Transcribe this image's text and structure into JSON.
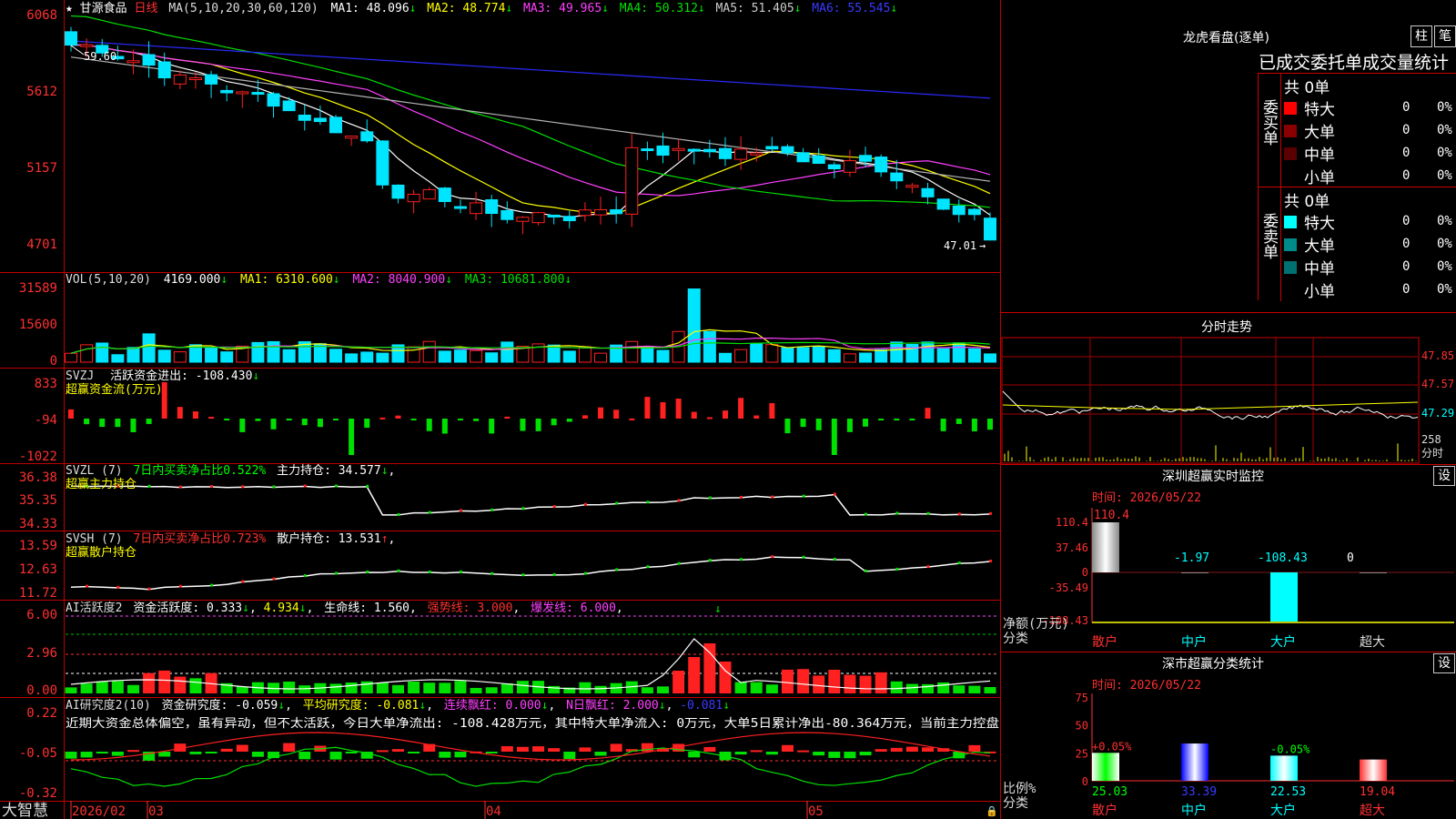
{
  "colors": {
    "up": "#ff2020",
    "down": "#00e5ff",
    "grid": "#a00000",
    "axis": "#ff3030",
    "white": "#ffffff",
    "yellow": "#ffff00",
    "magenta": "#ff40ff",
    "green": "#00e000",
    "blue": "#2a2aff",
    "gray": "#b4b4b4",
    "cyan": "#00ffff"
  },
  "header": {
    "star": "★",
    "stock": "甘源食品",
    "period": "日线",
    "ma_spec": "MA(5,10,20,30,60,120)",
    "ma": [
      {
        "label": "MA1: 48.096",
        "arrow": "↓"
      },
      {
        "label": "MA2: 48.774",
        "arrow": "↓"
      },
      {
        "label": "MA3: 49.965",
        "arrow": "↓"
      },
      {
        "label": "MA4: 50.312",
        "arrow": "↓"
      },
      {
        "label": "MA5: 51.405",
        "arrow": "↓"
      },
      {
        "label": "MA6: 55.545",
        "arrow": "↓"
      }
    ]
  },
  "price_panel": {
    "ticks": [
      "6068",
      "5612",
      "5157",
      "4701"
    ],
    "high_label": "59.60",
    "low_label": "47.01"
  },
  "vol_panel": {
    "title": "VOL(5,10,20)",
    "value": "4169.000",
    "ma1": "MA1: 6310.600",
    "ma2": "MA2: 8040.900",
    "ma3": "MA3: 10681.800",
    "arrow": "↓",
    "ticks": [
      "31589",
      "15600",
      "0"
    ]
  },
  "svzj_panel": {
    "title": "SVZJ",
    "label": "活跃资金进出: -108.430",
    "arrow": "↓",
    "sub": "超赢资金流(万元)",
    "ticks": [
      "833",
      "-94",
      "-1022"
    ]
  },
  "svzl_panel": {
    "title": "SVZL (7)",
    "label": "7日内买卖净占比0.522%",
    "label2": "主力持仓: 34.577",
    "arrow": "↓",
    "sub": "超赢主力持仓",
    "ticks": [
      "36.38",
      "35.35",
      "34.33"
    ]
  },
  "svsh_panel": {
    "title": "SVSH (7)",
    "label": "7日内买卖净占比0.723%",
    "label2": "散户持仓: 13.531",
    "arrow": "↑",
    "sub": "超赢散户持仓",
    "ticks": [
      "13.59",
      "12.63",
      "11.72"
    ]
  },
  "ai1_panel": {
    "title": "AI活跃度2",
    "label": "资金活跃度: 0.333",
    "a1": "↓",
    "v2": "4.934",
    "a2": "↓",
    "life": "生命线: 1.560",
    "strong": "强势线: 3.000",
    "burst": "爆发线: 6.000",
    "ticks": [
      "6.00",
      "2.96",
      "0.00"
    ]
  },
  "ai2_panel": {
    "title": "AI研究度2(10)",
    "label": "资金研究度: -0.059",
    "a1": "↓",
    "avg": "平均研究度: -0.081",
    "a2": "↓",
    "red": "连续飘红: 0.000",
    "a3": "↓",
    "nred": "N日飘红: 2.000",
    "a4": "↓",
    "v5": "-0.081",
    "a5": "↓",
    "note": "近期大资金总体偏空，虽有异动，但不太活跃，今日大单净流出: -108.428万元，其中特大单净流入: 0万元，大单5日累计净出-80.364万元，当前主力控盘",
    "ticks": [
      "0.22",
      "-0.05",
      "-0.32"
    ]
  },
  "xaxis": {
    "brand": "大智慧",
    "labels": [
      "2026/02",
      "03",
      "04",
      "05"
    ]
  },
  "lhb": {
    "title": "龙虎看盘(逐单)",
    "btn1": "柱",
    "btn2": "笔",
    "header": "已成交委托单成交量统计",
    "buy": {
      "side": "委买单",
      "total": "共 0单",
      "rows": [
        {
          "name": "特大",
          "v": "0",
          "p": "0%"
        },
        {
          "name": "大单",
          "v": "0",
          "p": "0%"
        },
        {
          "name": "中单",
          "v": "0",
          "p": "0%"
        },
        {
          "name": "小单",
          "v": "0",
          "p": "0%"
        }
      ]
    },
    "sell": {
      "side": "委卖单",
      "total": "共 0单",
      "rows": [
        {
          "name": "特大",
          "v": "0",
          "p": "0%"
        },
        {
          "name": "大单",
          "v": "0",
          "p": "0%"
        },
        {
          "name": "中单",
          "v": "0",
          "p": "0%"
        },
        {
          "name": "小单",
          "v": "0",
          "p": "0%"
        }
      ]
    }
  },
  "fenshi": {
    "title": "分时走势",
    "ticks": [
      "47.85",
      "47.57",
      "47.29"
    ],
    "vol": "258",
    "vol_label": "分时"
  },
  "sz_monitor": {
    "title": "深圳超赢实时监控",
    "btn": "设",
    "time": "时间: 2026/05/22",
    "ticks": [
      "110.4",
      "37.46",
      "0",
      "-35.49",
      "-108.43"
    ],
    "bars": [
      {
        "cat": "散户",
        "value": 110.4,
        "label": "110.4"
      },
      {
        "cat": "中户",
        "value": -1.97,
        "label": "-1.97"
      },
      {
        "cat": "大户",
        "value": -108.43,
        "label": "-108.43"
      },
      {
        "cat": "超大",
        "value": 0,
        "label": "0"
      }
    ],
    "ylabel1": "净额(万元)",
    "ylabel2": "分类"
  },
  "sz_stats": {
    "title": "深市超赢分类统计",
    "btn": "设",
    "time": "时间: 2026/05/22",
    "ticks": [
      "75",
      "50",
      "25",
      "0"
    ],
    "bars": [
      {
        "cat": "散户",
        "value": 25.03,
        "label": "25.03",
        "delta": "+0.05%"
      },
      {
        "cat": "中户",
        "value": 33.39,
        "label": "33.39",
        "delta": ""
      },
      {
        "cat": "大户",
        "value": 22.53,
        "label": "22.53",
        "delta": "-0.05%"
      },
      {
        "cat": "超大",
        "value": 19.04,
        "label": "19.04",
        "delta": ""
      }
    ],
    "ylabel1": "比例%",
    "ylabel2": "分类"
  }
}
